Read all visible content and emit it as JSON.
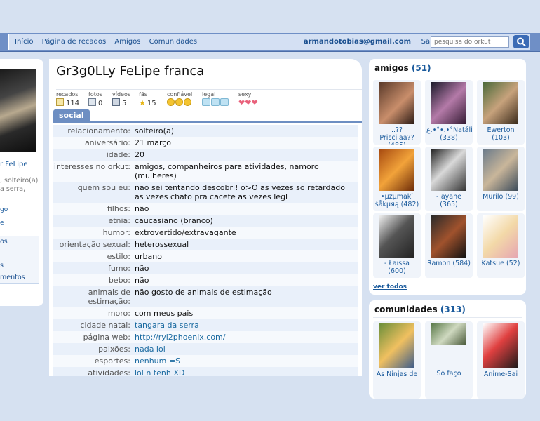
{
  "nav": {
    "items": [
      "Início",
      "Página de recados",
      "Amigos",
      "Comunidades"
    ],
    "user_email": "armandotobias@gmail.com",
    "logout": "Sair",
    "search_placeholder": "pesquisa do orkut"
  },
  "left": {
    "name": "r FeLipe",
    "info_line1": ", solteiro(a)",
    "info_line2": "a serra,",
    "link1": "go",
    "link2": "e",
    "menu": [
      "os",
      "",
      "s",
      "mentos"
    ]
  },
  "profile": {
    "name": "Gr3g0LLy FeLipe franca",
    "stats": {
      "recados_label": "recados",
      "recados": "114",
      "fotos_label": "fotos",
      "fotos": "0",
      "videos_label": "vídeos",
      "videos": "5",
      "fas_label": "fãs",
      "fas": "15",
      "confiavel_label": "confiável",
      "legal_label": "legal",
      "sexy_label": "sexy"
    },
    "tab": "social",
    "fields": [
      {
        "k": "relacionamento:",
        "v": "solteiro(a)"
      },
      {
        "k": "aniversário:",
        "v": "21 março"
      },
      {
        "k": "idade:",
        "v": "20"
      },
      {
        "k": "interesses no orkut:",
        "v": "amigos, companheiros para atividades, namoro (mulheres)"
      },
      {
        "k": "quem sou eu:",
        "v": "nao sei tentando descobri! o>O as vezes so retardado as vezes chato pra cacete as vezes legl"
      },
      {
        "k": "filhos:",
        "v": "não"
      },
      {
        "k": "etnia:",
        "v": "caucasiano (branco)"
      },
      {
        "k": "humor:",
        "v": "extrovertido/extravagante"
      },
      {
        "k": "orientação sexual:",
        "v": "heterossexual"
      },
      {
        "k": "estilo:",
        "v": "urbano"
      },
      {
        "k": "fumo:",
        "v": "não"
      },
      {
        "k": "bebo:",
        "v": "não"
      },
      {
        "k": "animais de estimação:",
        "v": "não gosto de animais de estimação"
      },
      {
        "k": "moro:",
        "v": "com meus pais"
      },
      {
        "k": "cidade natal:",
        "v": "tangara da serra",
        "link": true
      },
      {
        "k": "página web:",
        "v": "http://ryl2phoenix.com/",
        "link": true
      },
      {
        "k": "paixões:",
        "v": "nada lol",
        "link": true
      },
      {
        "k": "esportes:",
        "v": "nenhum =S",
        "link": true
      },
      {
        "k": "atividades:",
        "v": "lol n tenh XD",
        "link": true
      }
    ]
  },
  "friends": {
    "title": "amigos",
    "count": "(51)",
    "see_all": "ver todos",
    "items": [
      {
        "name": "..??Priscilaa??",
        "count": "(485)"
      },
      {
        "name": "ع.•°•.•°Natália",
        "count": "(338)"
      },
      {
        "name": "Ewerton",
        "count": "(103)"
      },
      {
        "name": "•µzµmakî šåkµяą",
        "count": "(482)"
      },
      {
        "name": "-Tayane",
        "count": "(365)"
      },
      {
        "name": "Murilo",
        "count": "(99)"
      },
      {
        "name": "- Łaıssa",
        "count": "(600)"
      },
      {
        "name": "Ramon",
        "count": "(584)"
      },
      {
        "name": "Katsue",
        "count": "(52)"
      }
    ]
  },
  "communities": {
    "title": "comunidades",
    "count": "(313)",
    "items": [
      "As Ninjas de",
      "Só faço",
      "Anime-Sai"
    ]
  },
  "colors": {
    "background": "#d6e1f1",
    "nav": "#6f8fc6",
    "link": "#1a5a9c",
    "tab": "#6d8ec2"
  }
}
